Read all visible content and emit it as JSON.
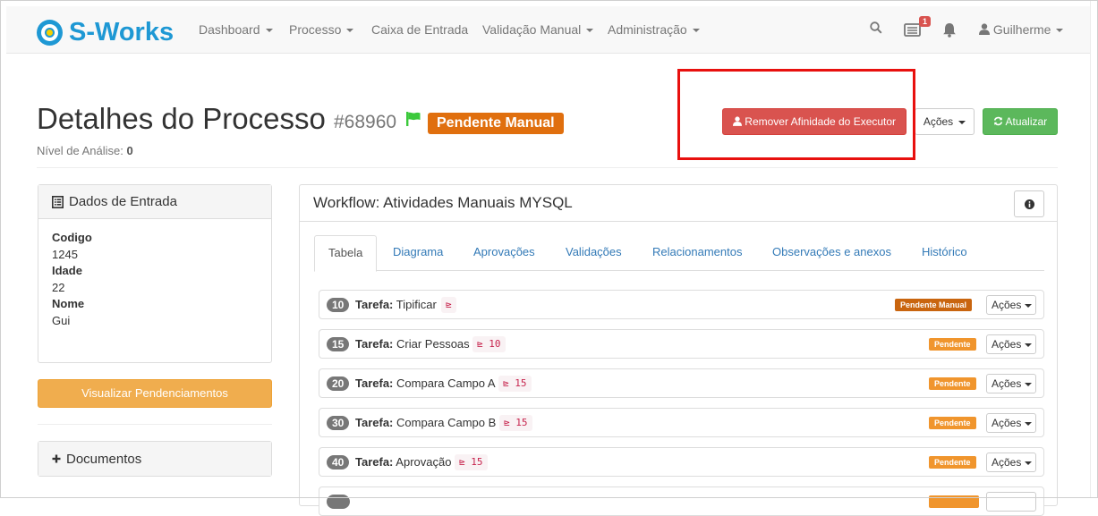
{
  "navbar": {
    "brand": "S-Works",
    "items": [
      {
        "label": "Dashboard",
        "dropdown": true
      },
      {
        "label": "Processo",
        "dropdown": true
      },
      {
        "label": "Caixa de Entrada",
        "dropdown": false
      },
      {
        "label": "Validação Manual",
        "dropdown": true
      },
      {
        "label": "Administração",
        "dropdown": true
      }
    ],
    "inbox_badge": "1",
    "user": "Guilherme"
  },
  "header": {
    "title": "Detalhes do Processo",
    "process_id": "#68960",
    "status": "Pendente Manual",
    "nivel_label": "Nível de Análise:",
    "nivel_value": "0"
  },
  "actions": {
    "remove_affinity": "Remover Afinidade do Executor",
    "acoes": "Ações",
    "atualizar": "Atualizar"
  },
  "dados_entrada": {
    "title": "Dados de Entrada",
    "fields": [
      {
        "key": "Codigo",
        "value": "1245"
      },
      {
        "key": "Idade",
        "value": "22"
      },
      {
        "key": "Nome",
        "value": "Gui"
      }
    ]
  },
  "visualizar_btn": "Visualizar Pendenciamentos",
  "documentos": "Documentos",
  "workflow": {
    "title": "Workflow: Atividades Manuais MYSQL",
    "tabs": [
      "Tabela",
      "Diagrama",
      "Aprovações",
      "Validações",
      "Relacionamentos",
      "Observações e anexos",
      "Histórico"
    ],
    "active_tab": "Tabela",
    "task_prefix": "Tarefa:",
    "task_action": "Ações",
    "tasks": [
      {
        "num": "10",
        "name": "Tipificar",
        "dep": "",
        "status": "Pendente Manual"
      },
      {
        "num": "15",
        "name": "Criar Pessoas",
        "dep": "10",
        "status": "Pendente"
      },
      {
        "num": "20",
        "name": "Compara Campo A",
        "dep": "15",
        "status": "Pendente"
      },
      {
        "num": "30",
        "name": "Compara Campo B",
        "dep": "15",
        "status": "Pendente"
      },
      {
        "num": "40",
        "name": "Aprovação",
        "dep": "15",
        "status": "Pendente"
      }
    ]
  },
  "colors": {
    "brand": "#1e98d4",
    "danger": "#d9534f",
    "success": "#5cb85c",
    "warning": "#f0ad4e",
    "status_manual": "#e06f0e",
    "highlight": "#e8100e"
  }
}
